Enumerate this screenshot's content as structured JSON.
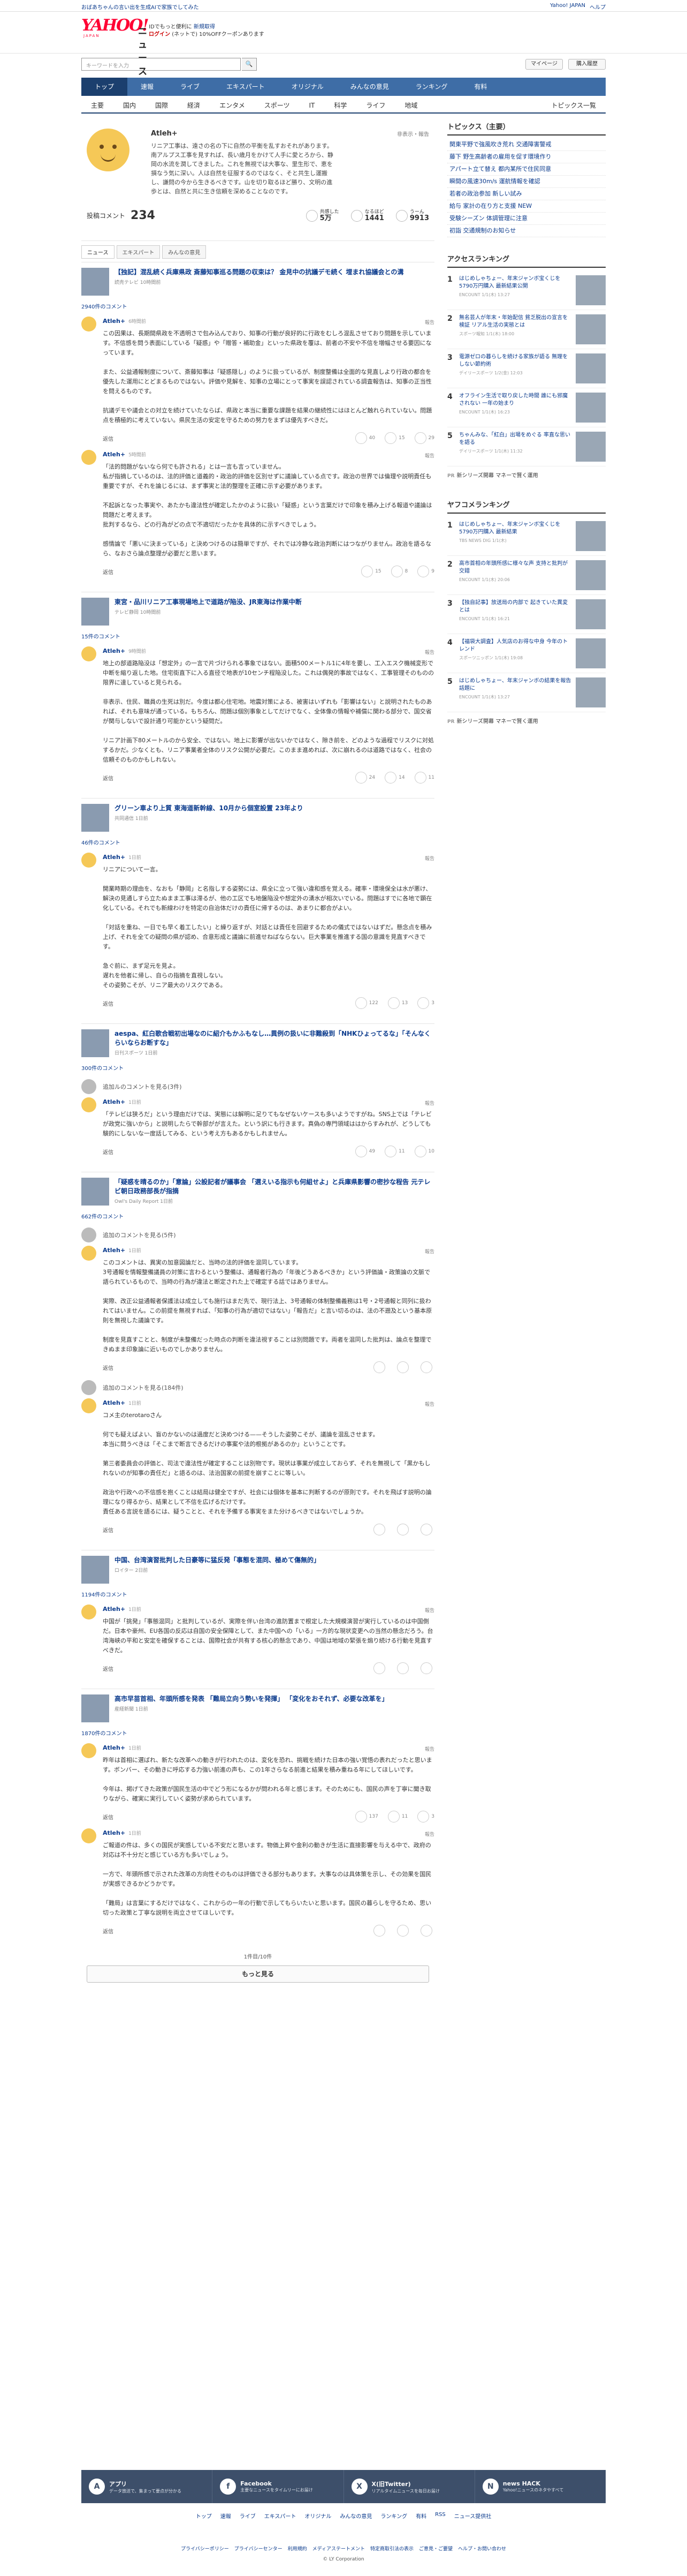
{
  "topbar": {
    "promo": "おばあちゃんの言い出を生成AIで家族でしてみた",
    "links": [
      "Yahoo! JAPAN",
      "ヘルプ"
    ]
  },
  "header": {
    "logo": "YAHOO!",
    "logo_sub": "JAPAN",
    "service": "ニュース",
    "msg1": "IDでもっと便利に",
    "msg1_link": "新規取得",
    "msg2_login": "ログイン",
    "msg2": "(ネットで) 10%OFFクーポンあります"
  },
  "search": {
    "placeholder": "キーワードを入力",
    "my": "マイページ",
    "help": "購入履歴"
  },
  "nav_main": [
    "トップ",
    "速報",
    "ライブ",
    "エキスパート",
    "オリジナル",
    "みんなの意見",
    "ランキング",
    "有料"
  ],
  "nav_sub": [
    "主要",
    "国内",
    "国際",
    "経済",
    "エンタメ",
    "スポーツ",
    "IT",
    "科学",
    "ライフ",
    "地域"
  ],
  "nav_sub_more": "トピックス一覧",
  "profile": {
    "name": "Atleh+",
    "follow": "非表示・報告",
    "bio": "リニア工事は、遠さの名の下に自然の平衡を乱すおそれがあります。南アルプス工事を見すれば、長い歳月をかけて人手に愛とろから、静岡の水流を潤してきました。これを無視では大事な、里生形で、恵を損なう気に深い。人は自然を征服するのではなく、そと共生し運搬し、謙問の今から生きるべきです。山を切り取るほど勝り、文明の進歩とは、自然と共に生き信頼を深めることなのです。",
    "count_label": "投稿コメント",
    "count": "234",
    "stats": [
      {
        "label": "共感した",
        "value": "5万"
      },
      {
        "label": "なるほど",
        "value": "1441"
      },
      {
        "label": "うーん",
        "value": "9913"
      }
    ]
  },
  "tabs": [
    "ニュース",
    "エキスパート",
    "みんなの意見"
  ],
  "articles": [
    {
      "title": "【独記】混乱続く兵庫県政 斎藤知事巡る問題の収束は？ 金見中の抗議デモ続く 埋まれ協議会との溝",
      "source": "読売テレビ 10時間前",
      "ccount": "2940件のコメント",
      "comments": [
        {
          "name": "Atleh+",
          "time": "6時間前",
          "report": "報告",
          "text": "この因果は、長期間県政を不透明さで包み込んでおり、知事の行動が良好的に行政をむしろ混乱させており問題を示しています。不信感を問う表面にしている「疑惑」や「贈答・補助金」といった県政を覆は、前者の不安や不信を増幅させる要因になっています。\n\nまた、公益通報制度について、斎藤知事は「疑惑隠し」のように扱っているが、制度整備は全面的な見直しより行政の都合を優先した運用にとどまるものではない。評価や見解を、知事の立場にとって事実を誤認されている調査報告は、知事の正当性を問えるものです。\n\n抗議デモや議会との対立を続けていたならば、県政と本当に重要な課題を結果の継続性にはほとんど触れられていない。問題点を積極的に考えていない。県民生活の安定を守るための努力をまずは優先すべきだ。",
          "votes": [
            "40",
            "15",
            "29"
          ]
        },
        {
          "name": "Atleh+",
          "time": "5時間前",
          "report": "報告",
          "text": "「法的問題がないなら何でも許される」とは一言も言っていません。\n私が指摘しているのは、法的評価と道義的・政治的評価を区別せずに議論している点です。政治の世界では倫理や説明責任も重要ですが、それを論じるには、まず事実と法的整理を正確に示す必要があります。\n\n不起訴となった事実や、あたかも違法性が確定したかのように扱い「疑惑」という言葉だけで印象を積み上げる報道や議論は問題だと考えます。\n批判するなら、どの行為がどの点で不適切だったかを具体的に示すべきでしょう。\n\n感情論で「悪いに決まっている」と決めつけるのは簡単ですが、それでは冷静な政治判断にはつながりません。政治を語るなら、なおさら論点整理が必要だと思います。",
          "votes": [
            "15",
            "8",
            "9"
          ]
        }
      ]
    },
    {
      "title": "東宮・品川リニア工事現場地上で道路が陥没、JR東海は作業中断",
      "source": "テレビ静岡 10時間前",
      "ccount": "15件のコメント",
      "comments": [
        {
          "name": "Atleh+",
          "time": "9時間前",
          "report": "報告",
          "text": "地上の部道路陥没は「想定外」の一言で片づけられる事象ではない。面積500メートル1に4年を要し、工入エスク機械変形で中断を縮り返した地。住宅街直下に入る直径で地表が10センチ程陥没した。これは偶発的事故ではなく、工事管理そのものの限界に達していると見られる。\n\n非表示、住民、職員の生死は別だ。今度は都心住宅地。地震対策による、被害はいずれも「影響はない」と説明されたものあれば、それも意味が通っている。もちろん、問題は個別事象としてだけでなく、全体像の情報や補償に関わる部分で、国交省が関与しないで設計通り可能かという疑問だ。\n\nリニア計画下80メートルのから安全、ではない。地上に影響が出ないかではなく、隙き前を、どのような過程でリスクに対処するかだ。少なくとも、リニア事業者全体のリスク公開が必要だ。このまま進めれば、次に崩れるのは道路ではなく、社会の信頼そのものかもしれない。",
          "votes": [
            "24",
            "14",
            "11"
          ]
        }
      ]
    },
    {
      "title": "グリーン車より上質 東海道新幹線、10月から個室設置 23年より",
      "source": "共同通信 1日前",
      "ccount": "46件のコメント",
      "comments": [
        {
          "name": "Atleh+",
          "time": "1日前",
          "report": "報告",
          "text": "リニアについて一言。\n\n開業時期の理由を、なおも「静岡」と名指しする姿勢には、県全に立って強い違和感を覚える。確率・環境保全は水が悪け、解決の見通しすら立たぬまま工事は滞るが、他の工区でも地盤陥没や想定外の湧水が相次いでいる。問題はすでに各地で顕在化している。それでも新線わけを特定の自治体だけの責任に帰するのは、あまりに都合がよい。\n\n「対話を重ね、一日でも早く着工したい」と繰り返すが、対話とは責任を回避するための儀式ではないはずだ。懸念点を積み上げ、それを全ての疑問の県が認め、合意形成と議論に前進せねばならない。巨大事業を推進する国の意識を見直すべきです。\n\n急ぐ前に、まず足元を見よ。\n遅れを他者に帰し、自らの指摘を直視しない。\nその姿勢こそが、リニア最大のリスクである。",
          "votes": [
            "122",
            "13",
            "3"
          ]
        }
      ]
    },
    {
      "title": "aespa、紅白歌合戦初出場なのに紹介もかふもなし…異例の扱いに非難殺到「NHKひょってるな」「そんなくらいならお断すな」",
      "source": "日刊スポーツ 1日前",
      "ccount": "300件のコメント",
      "hidden": "追加ルのコメントを見る(3件)",
      "comments": [
        {
          "name": "Atleh+",
          "time": "1日前",
          "report": "報告",
          "text": "「テレビは狭ろだ」という理由だけでは、実態には解明に足りてもなぜないケースも多いようですがね。SNS上では「テレビが政党に強いから」と説明したらで幹部がが言えた。という訳にも行きます。真偽の専門領域ははからすみれが、どうしても験的にしないな一度話してみる、という考え方もあるかもしれません。",
          "votes": [
            "49",
            "11",
            "10"
          ]
        }
      ]
    },
    {
      "title": "「疑惑を晴るのか」「意論」公設記者が議事会 「選えいる指示も何組せよ」と兵庫県影響の密抄な程告 元テレビ朝日政務部長が指摘",
      "source": "Owl's Daily Report 1日前",
      "ccount": "662件のコメント",
      "hidden": "追加のコメントを見る(5件)",
      "comments": [
        {
          "name": "Atleh+",
          "time": "1日前",
          "report": "報告",
          "text": "このコメントは、異実の加意図論だと、当時の法的評価を混同しています。\n3号通報を情報整備議員の対策に言わるという整備は、通報者行為の「年後どうあるべきか」という評価論・政策論の文脈で語られているもので、当時の行為が違法と断定された上で確定する話ではありません。\n\n実際、改正公益通報者保護法は成立しても施行はまだ先で、現行法上、3号通報の体制整備義務は1号・2号通報と同列に扱われてはいません。この前提を無視すれば、「知事の行為が適切ではない」「報告だ」と言い切るのは、法の不遡及という基本原則を無視した議論です。\n\n制度を見直すことと、制度が未整備だった時点の判断を違法視することは別問題です。両者を混同した批判は、論点を整理できぬまま印象論に近いものでしかありません。",
          "votes": [
            "",
            "",
            ""
          ]
        }
      ],
      "hidden2": "追加のコメントを見る(184件)",
      "comments2": [
        {
          "name": "Atleh+",
          "time": "1日前",
          "report": "報告",
          "text": "コメ主のterotaroさん\n\n何でも疑えばよい、盲のかないのは過度だと決めつける——そうした姿勢こそが、議論を混乱させます。\n本当に問うべきは「そこまで断言できるだけの事案や法的根拠があるのか」ということです。\n\n第三者委員会の評価と、司法で違法性が確定することは別物です。現状は事業が成立しておらず、それを無視して「黒かもしれないのが知事の責任だ」と語るのは、法治国家の前提を崩すことに等しい。\n\n政治や行政への不信感を抱くことは結局は健全ですが、社会には個体を基本に判断するのが原則です。それを飛ばす説明の論理になり得るから、結果として不信を広げるだけです。\n責任ある言説を語るには、疑うことと、それを予備する事実をまた分けるべきではないでしょうか。",
          "votes": [
            "",
            "",
            ""
          ]
        }
      ]
    },
    {
      "title": "中国、台湾演習批判した日豪等に猛反発「事態を混同、極めて傷無的」",
      "source": "ロイター 2日前",
      "ccount": "1194件のコメント",
      "comments": [
        {
          "name": "Atleh+",
          "time": "1日前",
          "report": "報告",
          "text": "中国が「挑発」「事態混同」と批判しているが、実際を伴い台湾の進防置まで根定した大規模演習が実行しているのは中国側だ。日本や豪州、EU各国の反応は自国の安全保障として、また中国への「いる」一方的な現状変更への当然の懸念だろう。台湾海峡の平和と安定を確保することは、国際社会が共有する核心的懸念であり、中国は地域の緊張を煽り続ける行動を見直すべきだ。",
          "votes": [
            "",
            "",
            ""
          ]
        }
      ]
    },
    {
      "title": "高市早苗首相、年頭所感を発表 「難局立向う勢いを発揮」 「変化をおそれず、必要な改革を」",
      "source": "産経新聞 1日前",
      "ccount": "1870件のコメント",
      "comments": [
        {
          "name": "Atleh+",
          "time": "1日前",
          "report": "報告",
          "text": "昨年は首相に選ばれ、新たな改革への動きが行われたのは、変化を恐れ、挑戦を続けた日本の強い覚悟の表れだったと思います。ボンバー、その動きに呼応する力強い前進の声も、この1年さらなる前進と結果を積み重ねる年にしてほしいです。\n\n今年は、掲げてきた政策が国民生活の中でどう形になるかが問われる年と感じます。そのためにも、国民の声を丁寧に聞き取りながら、確実に実行していく姿勢が求められています。",
          "votes": [
            "137",
            "11",
            "3"
          ]
        },
        {
          "name": "Atleh+",
          "time": "1日前",
          "report": "報告",
          "text": "ご報道の件は、多くの国民が実感している不安だと思います。物価上昇や金利の動きが生活に直接影響を与える中で、政府の対応は不十分だと感じている方も多いでしょう。\n\n一方で、年頭所感で示された改革の方向性そのものは評価できる部分もあります。大事なのは具体策を示し、その効果を国民が実感できるかどうかです。\n\n「難局」は言葉にするだけではなく、これからの一年の行動で示してもらいたいと思います。国民の暮らしを守るため、思い切った政策と丁寧な説明を両立させてほしいです。",
          "votes": [
            "",
            "",
            ""
          ]
        }
      ]
    }
  ],
  "pager": "1件目/10件",
  "more": "もっと見る",
  "topics": {
    "title": "トピックス（主要）",
    "items": [
      "関東平野で強風吹き荒れ 交通障害警戒",
      "藤下 野生高齢者の雇用を促す環境作り",
      "アパート立て替え 都内某所で住民同意",
      "瞬間の風速30m/s 運航情報を確認",
      "若者の政治参加 新しい試み",
      "給与 家計の在り方と支援 NEW",
      "受験シーズン 体調管理に注意",
      "初詣 交通規制のお知らせ"
    ]
  },
  "ranking1": {
    "title": "アクセスランキング",
    "items": [
      {
        "n": "1",
        "t": "はじめしゃちょー、年末ジャンボ宝くじを5790万円購入 最新結果公開",
        "s": "ENCOUNT 1/1(木) 13:27"
      },
      {
        "n": "2",
        "t": "無名芸人が年末・年始配信 貧乏脱出の宣言を検証 リアル生活の実態とは",
        "s": "スポーツ報知 1/1(木) 18:00"
      },
      {
        "n": "3",
        "t": "電源ゼロの暮らしを続ける家族が語る 無理をしない節約術",
        "s": "デイリースポーツ 1/2(金) 12:03"
      },
      {
        "n": "4",
        "t": "オフライン生活で取り戻した時間 誰にも邪魔されない 一年の始まり",
        "s": "ENCOUNT 1/1(木) 16:23"
      },
      {
        "n": "5",
        "t": "ちゃんみな、「紅白」出場をめぐる 率直な思いを語る",
        "s": "デイリースポーツ 1/1(木) 11:32"
      }
    ]
  },
  "pr1": "新シリーズ開幕 マネーで賢く運用",
  "ranking2": {
    "title": "ヤフコメランキング",
    "items": [
      {
        "n": "1",
        "t": "はじめしゃちょー、年末ジャンボ宝くじを5790万円購入 最新結果",
        "s": "TBS NEWS DIG 1/1(木)"
      },
      {
        "n": "2",
        "t": "高市首相の年頭所感に様々な声 支持と批判が交錯",
        "s": "ENCOUNT 1/1(木) 20:06"
      },
      {
        "n": "3",
        "t": "【独自記事】放送局の内部で 起きていた異変とは",
        "s": "ENCOUNT 1/1(木) 16:21"
      },
      {
        "n": "4",
        "t": "【福袋大調査】人気店のお得な中身 今年のトレンド",
        "s": "スポーツニッポン 1/1(木) 19:08"
      },
      {
        "n": "5",
        "t": "はじめしゃちょー、年末ジャンボの結果を報告 話題に",
        "s": "ENCOUNT 1/1(木) 13:27"
      }
    ]
  },
  "pr2": "新シリーズ開幕 マネーで賢く運用",
  "footer": {
    "cells": [
      {
        "icon": "A",
        "title": "アプリ",
        "sub": "データ放送で、集まって要点が分かる"
      },
      {
        "icon": "f",
        "title": "Facebook",
        "sub": "主要なニュースをタイムリーにお届け"
      },
      {
        "icon": "X",
        "title": "X(旧Twitter)",
        "sub": "リアルタイムニュースを毎日お届け"
      },
      {
        "icon": "N",
        "title": "news HACK",
        "sub": "Yahoo!ニュースのネタやすべて"
      }
    ],
    "nav": [
      "トップ",
      "速報",
      "ライブ",
      "エキスパート",
      "オリジナル",
      "みんなの意見",
      "ランキング",
      "有料",
      "RSS",
      "ニュース提供社"
    ],
    "legal": [
      "プライバシーポリシー",
      "プライバシーセンター",
      "利用規約",
      "メディアステートメント",
      "特定商取引法の表示",
      "ご意見・ご要望",
      "ヘルプ・お問い合わせ"
    ],
    "copy": "© LY Corporation"
  }
}
